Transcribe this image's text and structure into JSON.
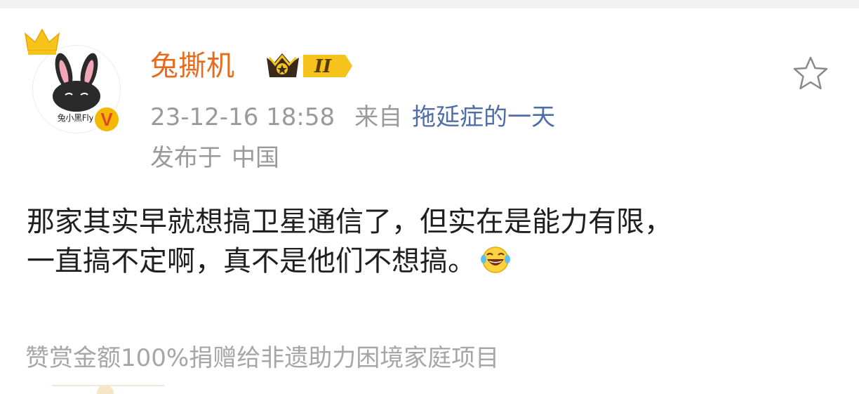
{
  "post": {
    "author": {
      "name": "兔撕机",
      "avatar_caption": "兔小黑Flyi",
      "verified_badge": "V",
      "level_badge": "II"
    },
    "timestamp": "23-12-16 18:58",
    "source_prefix": "来自",
    "source_app": "拖延症的一天",
    "location_prefix": "发布于",
    "location": "中国",
    "body_line1": "那家其实早就想搞卫星通信了，但实在是能力有限，",
    "body_line2": "一直搞不定啊，真不是他们不想搞。",
    "emoji": "laughing-tears",
    "reward_text": "赞赏金额100%捐赠给非遗助力困境家庭项目",
    "favorite_icon": "star-outline-icon"
  },
  "colors": {
    "username": "#e86a1d",
    "source_link": "#4f6ea8",
    "meta_gray": "#9a9a9a",
    "body_text": "#1f1f1f"
  }
}
